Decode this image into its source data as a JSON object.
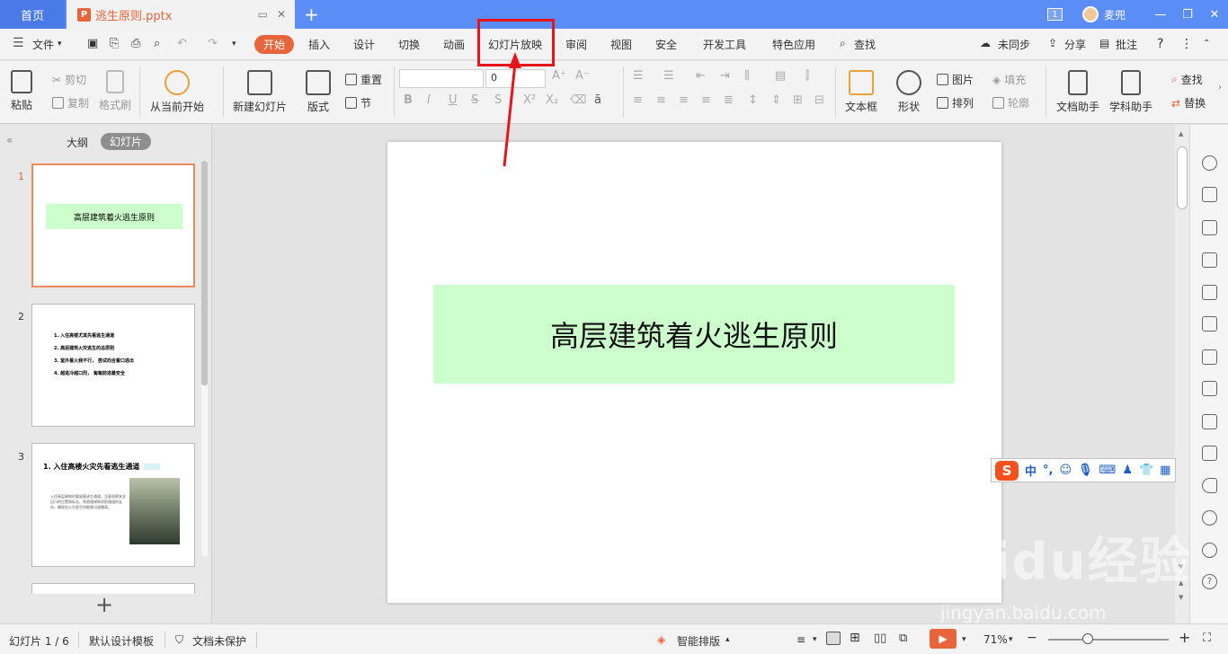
{
  "titlebar": {
    "home_tab": "首页",
    "doc_tab": "逃生原则.pptx",
    "doc_icon": "P",
    "new_tab_icon": "+",
    "user_name": "麦兜",
    "badge": "1"
  },
  "menu": {
    "file": "文件",
    "items": [
      "开始",
      "插入",
      "设计",
      "切换",
      "动画",
      "幻灯片放映",
      "审阅",
      "视图",
      "安全",
      "开发工具",
      "特色应用"
    ],
    "search": "查找",
    "sync": "未同步",
    "share": "分享",
    "comment": "批注"
  },
  "ribbon": {
    "paste": "粘贴",
    "cut": "剪切",
    "copy": "复制",
    "format_painter": "格式刷",
    "from_current": "从当前开始",
    "new_slide": "新建幻灯片",
    "layout": "版式",
    "reset": "重置",
    "section": "节",
    "font_size": "0",
    "textbox": "文本框",
    "shape": "形状",
    "picture": "图片",
    "arrange": "排列",
    "fill": "填充",
    "outline": "轮廓",
    "doc_helper": "文档助手",
    "subject_helper": "学科助手",
    "find": "查找",
    "replace": "替换"
  },
  "left_pane": {
    "outline_tab": "大纲",
    "slides_tab": "幻灯片",
    "add_icon": "+",
    "thumbs": [
      {
        "num": "1",
        "title": "高层建筑着火逃生原则"
      },
      {
        "num": "2",
        "lines": [
          "1. 入住高楼尤其先看逃生通道",
          "2. 高层建筑火灾逃生的总原则",
          "3. 室外着火我不行， 尝试向合着口逃出",
          "4. 越逃冷越口烈，  匐匐前进最安全"
        ]
      },
      {
        "num": "3",
        "title": "1. 入住高楼火灾先看逃生通道",
        "text": "入住高层建筑时要留意逃生通道，注意观察安全出口的位置和标志，熟悉楼梯和消防通道的走向，确保在火灾发生时能够迅速撤离。"
      }
    ]
  },
  "slide": {
    "title": "高层建筑着火逃生原则"
  },
  "ime": {
    "logo": "S",
    "mode": "中",
    "punct": "°,"
  },
  "status": {
    "slide_counter": "幻灯片 1 / 6",
    "template": "默认设计模板",
    "protection": "文档未保护",
    "smart_layout": "智能排版",
    "zoom": "71%",
    "zoom_minus": "−",
    "zoom_plus": "+"
  },
  "watermark": {
    "main": "Baidu经验",
    "sub": "jingyan.baidu.com"
  },
  "colors": {
    "titlebar": "#5b8df6",
    "accent": "#e8643a",
    "highlight_box": "#e8141c",
    "slide_band": "#ccffcc"
  }
}
